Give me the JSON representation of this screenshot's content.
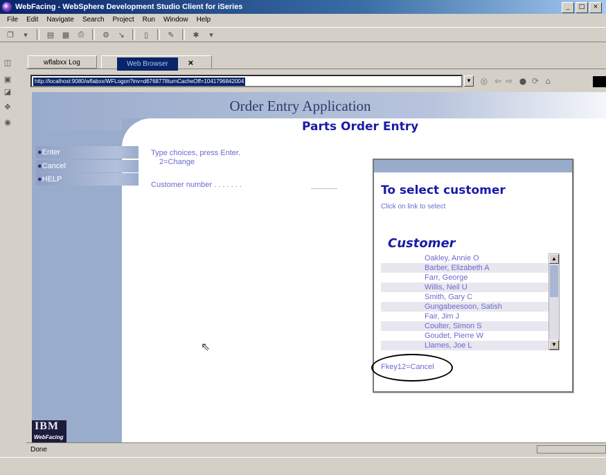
{
  "window": {
    "title": "WebFacing - WebSphere Development Studio Client for iSeries",
    "minimize": "_",
    "maximize": "□",
    "close": "×"
  },
  "menu": [
    "File",
    "Edit",
    "Navigate",
    "Search",
    "Project",
    "Run",
    "Window",
    "Help"
  ],
  "tabs": {
    "log": "wflabxx Log",
    "browser": "Web Browser",
    "close": "×"
  },
  "browser": {
    "url": "http://localhost:9080/wflabxx/WFLogon?inv=d6768778turnCacheOff=1041796842004",
    "status": "Done"
  },
  "page": {
    "app_title": "Order Entry Application",
    "subtitle": "Parts Order Entry",
    "function_keys": [
      "Enter",
      "Cancel",
      "HELP"
    ],
    "instructions": [
      "Type choices, press Enter.",
      "2=Change"
    ],
    "customer_label": "Customer number . . . . . . .",
    "logo_text": "IBM",
    "logo_sub": "WebFacing"
  },
  "popup": {
    "title": "To select customer",
    "subtitle": "Click on link to select",
    "heading": "Customer",
    "customers": [
      "Oakley, Annie O",
      "Barber, Elizabeth A",
      "Farr, George",
      "Willis, Neil U",
      "Smith, Gary C",
      "Gungabeesoon, Satish",
      "Fair, Jim J",
      "Coulter, Simon S",
      "Goudet, Pierre W",
      "Llames, Joe L"
    ],
    "cancel_link": "Fkey12=Cancel"
  }
}
